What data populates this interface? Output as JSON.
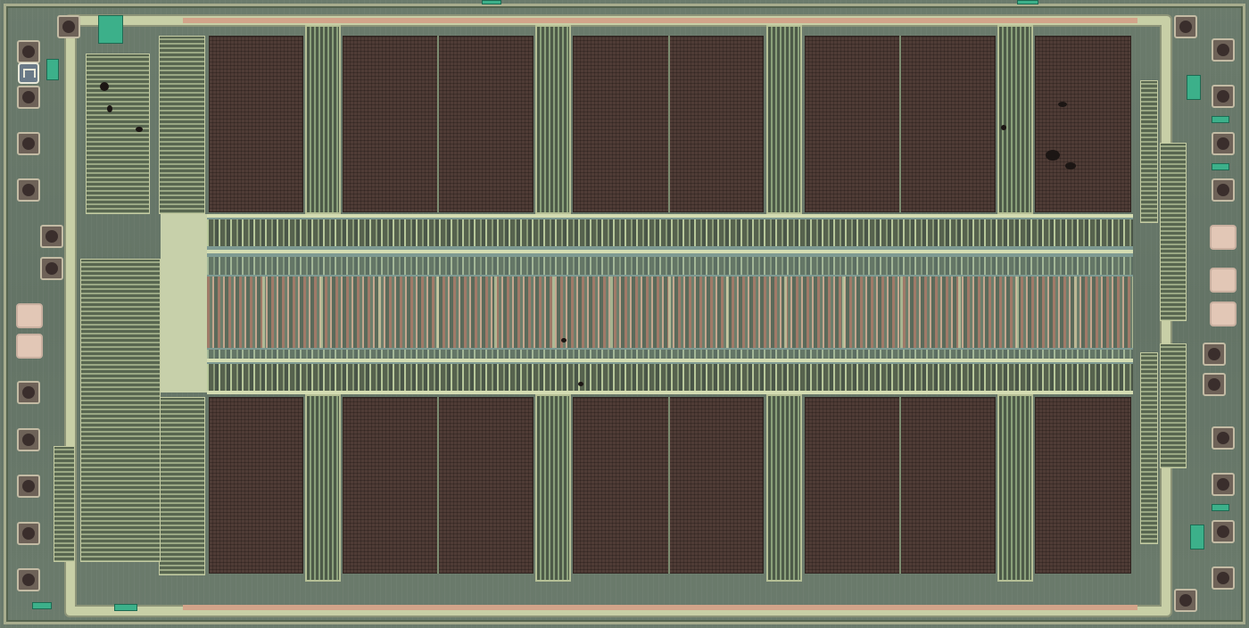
{
  "image": {
    "subject": "memory-chip-die-micrograph",
    "palette": {
      "substrate": "#647466",
      "memory_array": "#4f3c36",
      "metal_rail": "#c8cfa6",
      "sense_band": "#7e9a92",
      "bond_pad_ring": "#c3bba4",
      "teal_block": "#3cb08a",
      "top_strip": "#d2a48a"
    },
    "counts": {
      "array_blocks_per_half": 5,
      "halves": 2,
      "column_decoders_per_half": 4
    }
  }
}
